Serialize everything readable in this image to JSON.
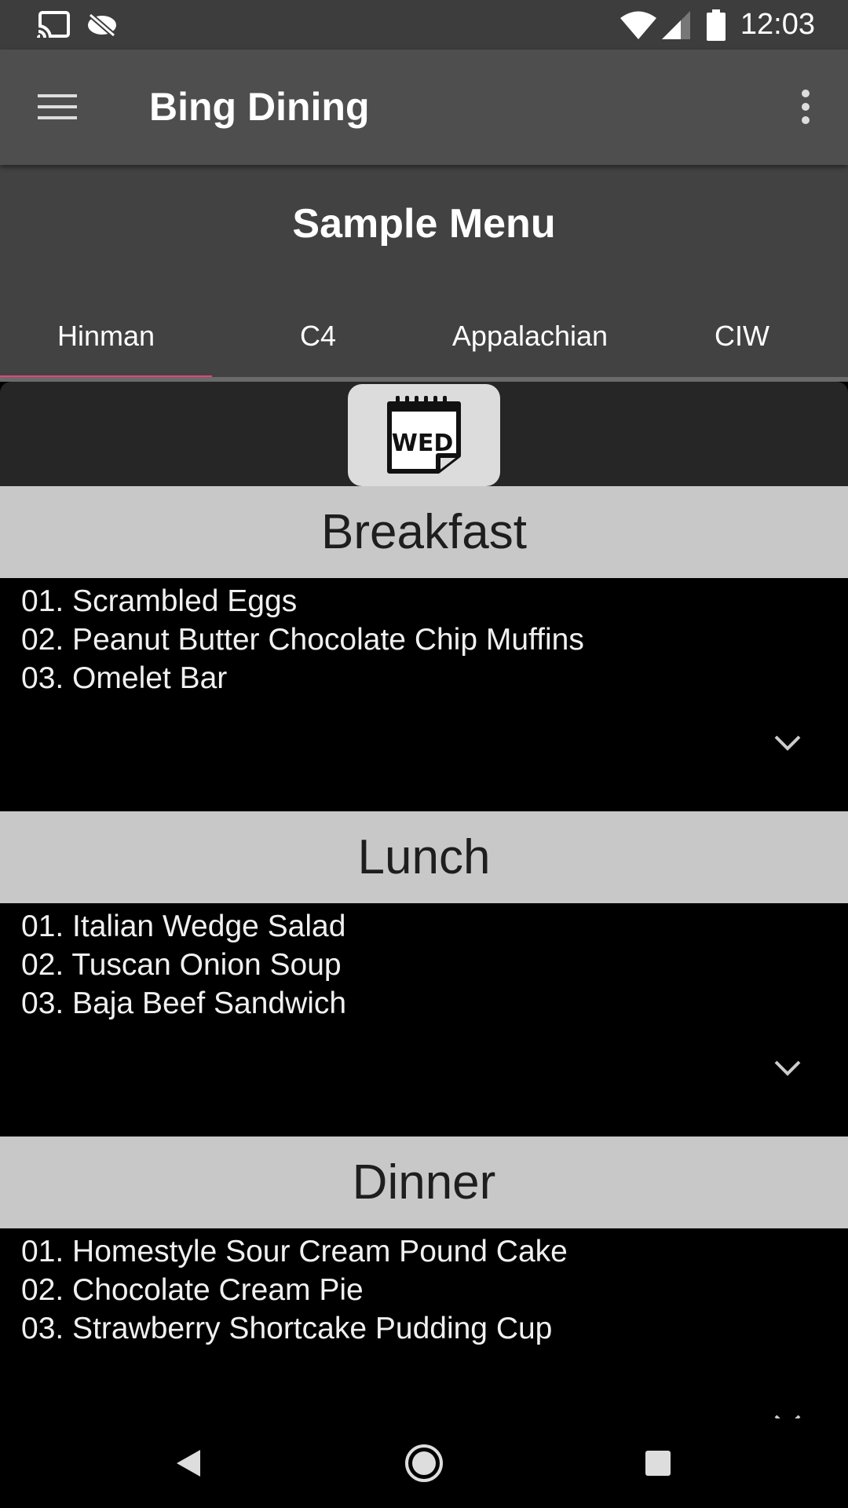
{
  "status_bar": {
    "time": "12:03",
    "icons": [
      "cast-icon",
      "sync-off-icon",
      "wifi-icon",
      "cell-signal-icon",
      "battery-icon"
    ]
  },
  "app_bar": {
    "title": "Bing Dining",
    "menu_icon": "hamburger-menu-icon",
    "overflow_icon": "more-vert-icon"
  },
  "page": {
    "title": "Sample Menu"
  },
  "tabs": [
    {
      "label": "Hinman",
      "selected": true
    },
    {
      "label": "C4",
      "selected": false
    },
    {
      "label": "Appalachian",
      "selected": false
    },
    {
      "label": "CIW",
      "selected": false
    }
  ],
  "day_badge": {
    "label": "WED",
    "icon": "calendar-day-icon"
  },
  "meals": [
    {
      "name": "Breakfast",
      "items": [
        "01. Scrambled Eggs",
        "02. Peanut Butter Chocolate Chip Muffins",
        "03. Omelet Bar"
      ]
    },
    {
      "name": "Lunch",
      "items": [
        "01. Italian Wedge Salad",
        "02. Tuscan Onion Soup",
        "03. Baja Beef Sandwich"
      ]
    },
    {
      "name": "Dinner",
      "items": [
        "01. Homestyle Sour Cream Pound Cake",
        "02. Chocolate Cream Pie",
        "03. Strawberry Shortcake Pudding Cup"
      ]
    }
  ],
  "colors": {
    "accent": "#e8417a",
    "app_bar": "#4e4e4e",
    "header": "#424242",
    "meal_header": "#c8c8c8"
  },
  "nav_bar": {
    "icons": [
      "back-icon",
      "home-icon",
      "recents-icon"
    ]
  }
}
